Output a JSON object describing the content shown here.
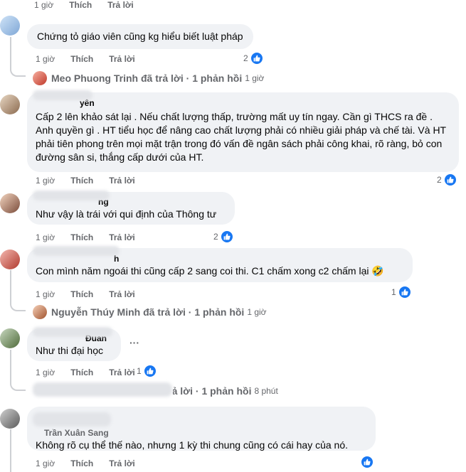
{
  "labels": {
    "like": "Thích",
    "reply": "Trả lời"
  },
  "comments": [
    {
      "time": "1 giờ",
      "text": "Chứng tỏ giáo viên cũng kg hiểu biết luật pháp",
      "reactions": "2"
    },
    {
      "author_partial": "yên",
      "text": "Cấp 2 lên khảo sát lại . Nếu chất lượng thấp, trường mất uy tín ngay. Cần gì THCS ra đề . Anh quyền gì . HT tiểu học để nâng cao chất lượng phải có nhiều giải pháp và chế tài. Và HT phải tiên phong trên mọi mặt trận trong đó vấn đề ngân sách phải công khai, rõ ràng, bỏ con đường sân si, thắng cấp dưới của HT.",
      "time": "1 giờ",
      "reactions": "2"
    },
    {
      "author_partial": "ng",
      "text": "Như vậy là trái với qui định của Thông tư",
      "time": "1 giờ",
      "reactions": "2"
    },
    {
      "author_partial": "h",
      "text": "Con mình năm ngoái thi cũng cấp 2 sang coi thi. C1 chấm xong c2 chấm lại",
      "emoji": "🤣",
      "time": "1 giờ",
      "reactions": "1"
    },
    {
      "author_partial": "Đuan",
      "text": "Như thi đại học",
      "time": "1 giờ",
      "reactions": "1",
      "more": "···"
    },
    {
      "author_partial": "Trần Xuân Sang",
      "text": "Không rõ cụ thể thế nào, nhưng 1 kỳ thi chung cũng có cái hay của nó.",
      "time": "1 giờ",
      "reactions": ""
    }
  ],
  "reply_summaries": [
    {
      "name": "Meo Phuong Trinh",
      "action": "đã trả lời",
      "sep": "·",
      "count": "1 phản hồi",
      "time": "1 giờ"
    },
    {
      "name": "Nguyễn Thúy Minh",
      "action": "đã trả lời",
      "sep": "·",
      "count": "1 phản hồi",
      "time": "1 giờ"
    },
    {
      "name": "",
      "action": "đã trả lời",
      "sep": "·",
      "count": "1 phản hồi",
      "time": "8 phút"
    }
  ],
  "icons": {
    "like": "thumbs-up-icon",
    "haha": "laughing-emoji-icon"
  },
  "colors": {
    "like_blue": "#1877f2",
    "bubble": "#f0f2f5",
    "meta": "#65676b"
  }
}
